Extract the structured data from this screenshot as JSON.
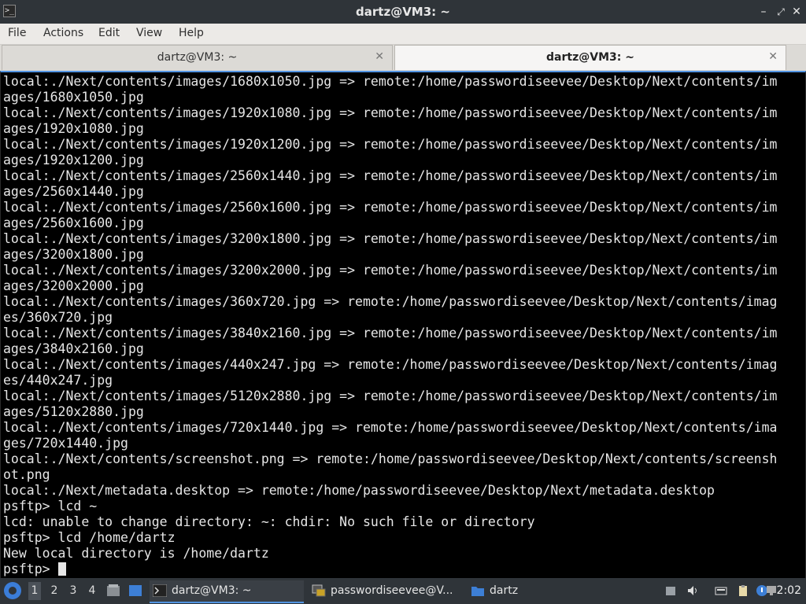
{
  "window": {
    "title": "dartz@VM3: ~",
    "icons": {
      "app": "terminal-icon",
      "minimize": "minimize-icon",
      "maximize": "maximize-icon",
      "close": "close-icon"
    }
  },
  "menu": [
    "File",
    "Actions",
    "Edit",
    "View",
    "Help"
  ],
  "tabs": [
    {
      "label": "dartz@VM3: ~",
      "active": false
    },
    {
      "label": "dartz@VM3: ~",
      "active": true
    }
  ],
  "terminal": {
    "lines": [
      "local:./Next/contents/images/1680x1050.jpg => remote:/home/passwordiseevee/Desktop/Next/contents/im",
      "ages/1680x1050.jpg",
      "local:./Next/contents/images/1920x1080.jpg => remote:/home/passwordiseevee/Desktop/Next/contents/im",
      "ages/1920x1080.jpg",
      "local:./Next/contents/images/1920x1200.jpg => remote:/home/passwordiseevee/Desktop/Next/contents/im",
      "ages/1920x1200.jpg",
      "local:./Next/contents/images/2560x1440.jpg => remote:/home/passwordiseevee/Desktop/Next/contents/im",
      "ages/2560x1440.jpg",
      "local:./Next/contents/images/2560x1600.jpg => remote:/home/passwordiseevee/Desktop/Next/contents/im",
      "ages/2560x1600.jpg",
      "local:./Next/contents/images/3200x1800.jpg => remote:/home/passwordiseevee/Desktop/Next/contents/im",
      "ages/3200x1800.jpg",
      "local:./Next/contents/images/3200x2000.jpg => remote:/home/passwordiseevee/Desktop/Next/contents/im",
      "ages/3200x2000.jpg",
      "local:./Next/contents/images/360x720.jpg => remote:/home/passwordiseevee/Desktop/Next/contents/imag",
      "es/360x720.jpg",
      "local:./Next/contents/images/3840x2160.jpg => remote:/home/passwordiseevee/Desktop/Next/contents/im",
      "ages/3840x2160.jpg",
      "local:./Next/contents/images/440x247.jpg => remote:/home/passwordiseevee/Desktop/Next/contents/imag",
      "es/440x247.jpg",
      "local:./Next/contents/images/5120x2880.jpg => remote:/home/passwordiseevee/Desktop/Next/contents/im",
      "ages/5120x2880.jpg",
      "local:./Next/contents/images/720x1440.jpg => remote:/home/passwordiseevee/Desktop/Next/contents/ima",
      "ges/720x1440.jpg",
      "local:./Next/contents/screenshot.png => remote:/home/passwordiseevee/Desktop/Next/contents/screensh",
      "ot.png",
      "local:./Next/metadata.desktop => remote:/home/passwordiseevee/Desktop/Next/metadata.desktop",
      "psftp> lcd ~",
      "lcd: unable to change directory: ~: chdir: No such file or directory",
      "psftp> lcd /home/dartz",
      "New local directory is /home/dartz"
    ],
    "prompt": "psftp> "
  },
  "taskbar": {
    "start_icon": "lxqt-menu-icon",
    "workspaces": [
      "1",
      "2",
      "3",
      "4"
    ],
    "active_workspace": "1",
    "launchers": [
      "file-manager-icon",
      "show-desktop-icon"
    ],
    "tasks": [
      {
        "label": "dartz@VM3: ~",
        "icon": "terminal-icon",
        "active": true
      },
      {
        "label": "passwordiseevee@V...",
        "icon": "network-terminal-icon",
        "active": false
      },
      {
        "label": "dartz",
        "icon": "folder-icon",
        "active": false
      }
    ],
    "tray_icons": [
      "removable-drive-icon",
      "volume-icon",
      "keyboard-icon",
      "clipboard-icon",
      "notification-icon",
      "network-icon"
    ],
    "clock": "2:02"
  },
  "colors": {
    "accent": "#5294e2",
    "terminal_bg": "#000000",
    "terminal_fg": "#e6e6e6",
    "titlebar": "#2f3439"
  }
}
